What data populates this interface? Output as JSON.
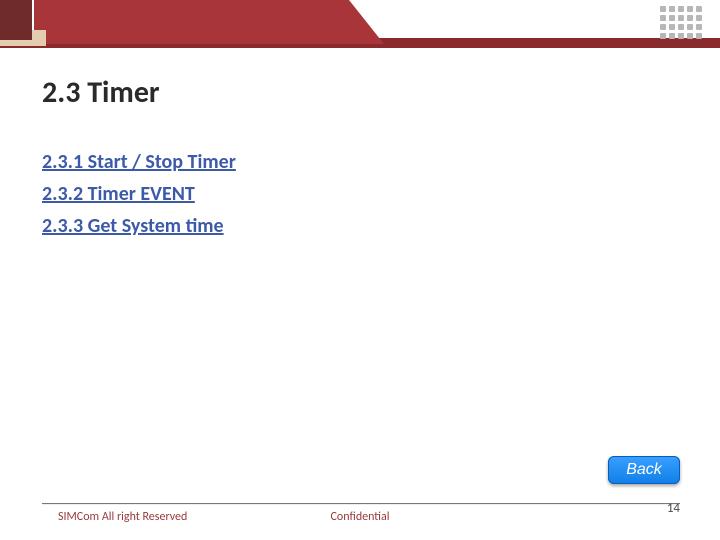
{
  "title": "2.3 Timer",
  "links": [
    {
      "label": "2.3.1 Start / Stop Timer"
    },
    {
      "label": "2.3.2 Timer EVENT"
    },
    {
      "label": "2.3.3 Get System time"
    }
  ],
  "back_label": "Back",
  "footer": {
    "left": "SIMCom All right Reserved",
    "center": "Confidential",
    "page": "14"
  }
}
